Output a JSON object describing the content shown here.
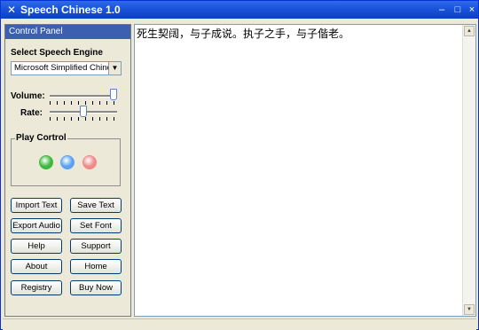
{
  "window": {
    "title": "Speech Chinese 1.0",
    "controls": {
      "minimize": "–",
      "maximize": "□",
      "close": "×"
    }
  },
  "panel": {
    "header": "Control Panel",
    "engine_label": "Select Speech Engine",
    "engine_value": "Microsoft Simplified Chinese",
    "volume_label": "Volume:",
    "rate_label": "Rate:",
    "volume_level_percent": 100,
    "rate_level_percent": 50,
    "play_group_label": "Play Cortrol",
    "play_buttons": [
      {
        "name": "play",
        "color": "#3FB83F"
      },
      {
        "name": "pause",
        "color": "#5AA2F0"
      },
      {
        "name": "stop",
        "color": "#F08A8A"
      }
    ],
    "buttons": {
      "import_text": "Import Text",
      "save_text": "Save Text",
      "export_audio": "Export Audio",
      "set_font": "Set Font",
      "help": "Help",
      "support": "Support",
      "about": "About",
      "home": "Home",
      "registry": "Registry",
      "buy_now": "Buy Now"
    }
  },
  "editor": {
    "text": "死生契阔，与子成说。执子之手，与子偕老。"
  },
  "colors": {
    "title_bar": "#1C56DB",
    "panel_header": "#3C5FB0",
    "accent_border": "#003C74"
  }
}
